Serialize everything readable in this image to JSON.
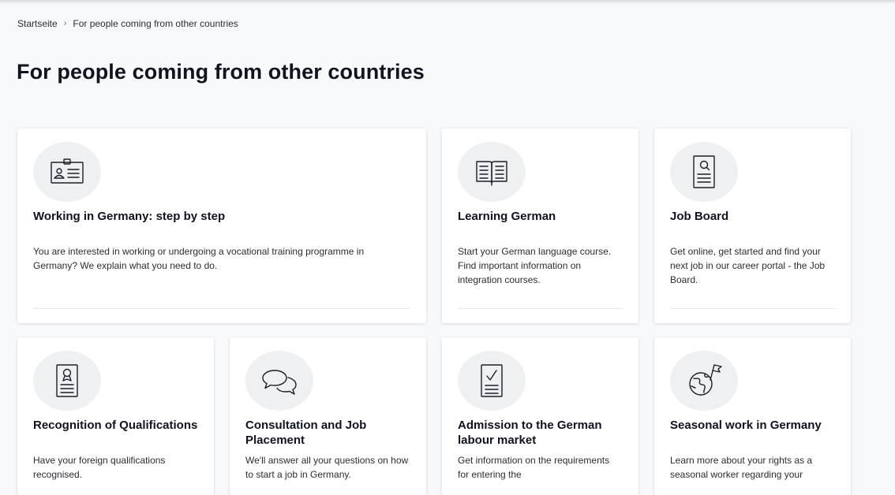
{
  "breadcrumb": {
    "home": "Startseite",
    "separator": "›",
    "current": "For people coming from other countries"
  },
  "page": {
    "title": "For people coming from other countries"
  },
  "cards": [
    {
      "icon": "id-card-icon",
      "title": "Working in Germany: step by step",
      "text": "You are interested in working or undergoing a vocational training programme in Germany? We explain what you need to do."
    },
    {
      "icon": "open-book-icon",
      "title": "Learning German",
      "text": "Start your German language course. Find important information on integration courses."
    },
    {
      "icon": "document-search-icon",
      "title": "Job Board",
      "text": "Get online, get started and find your next job in our career portal - the Job Board."
    },
    {
      "icon": "certificate-icon",
      "title": "Recognition of Qualifications",
      "text": "Have your foreign qualifications recognised."
    },
    {
      "icon": "speech-bubbles-icon",
      "title": "Consultation and Job Placement",
      "text": "We'll answer all your questions on how to start a job in Germany."
    },
    {
      "icon": "checklist-document-icon",
      "title": "Admission to the German labour market",
      "text": "Get information on the requirements for entering the"
    },
    {
      "icon": "globe-flag-icon",
      "title": "Seasonal work in Germany",
      "text": "Learn more about your rights as a seasonal worker regarding your"
    }
  ],
  "colors": {
    "background": "#f8f9fb",
    "card": "#ffffff",
    "icon_circle": "#eef0f1",
    "heading": "#0f1420"
  }
}
